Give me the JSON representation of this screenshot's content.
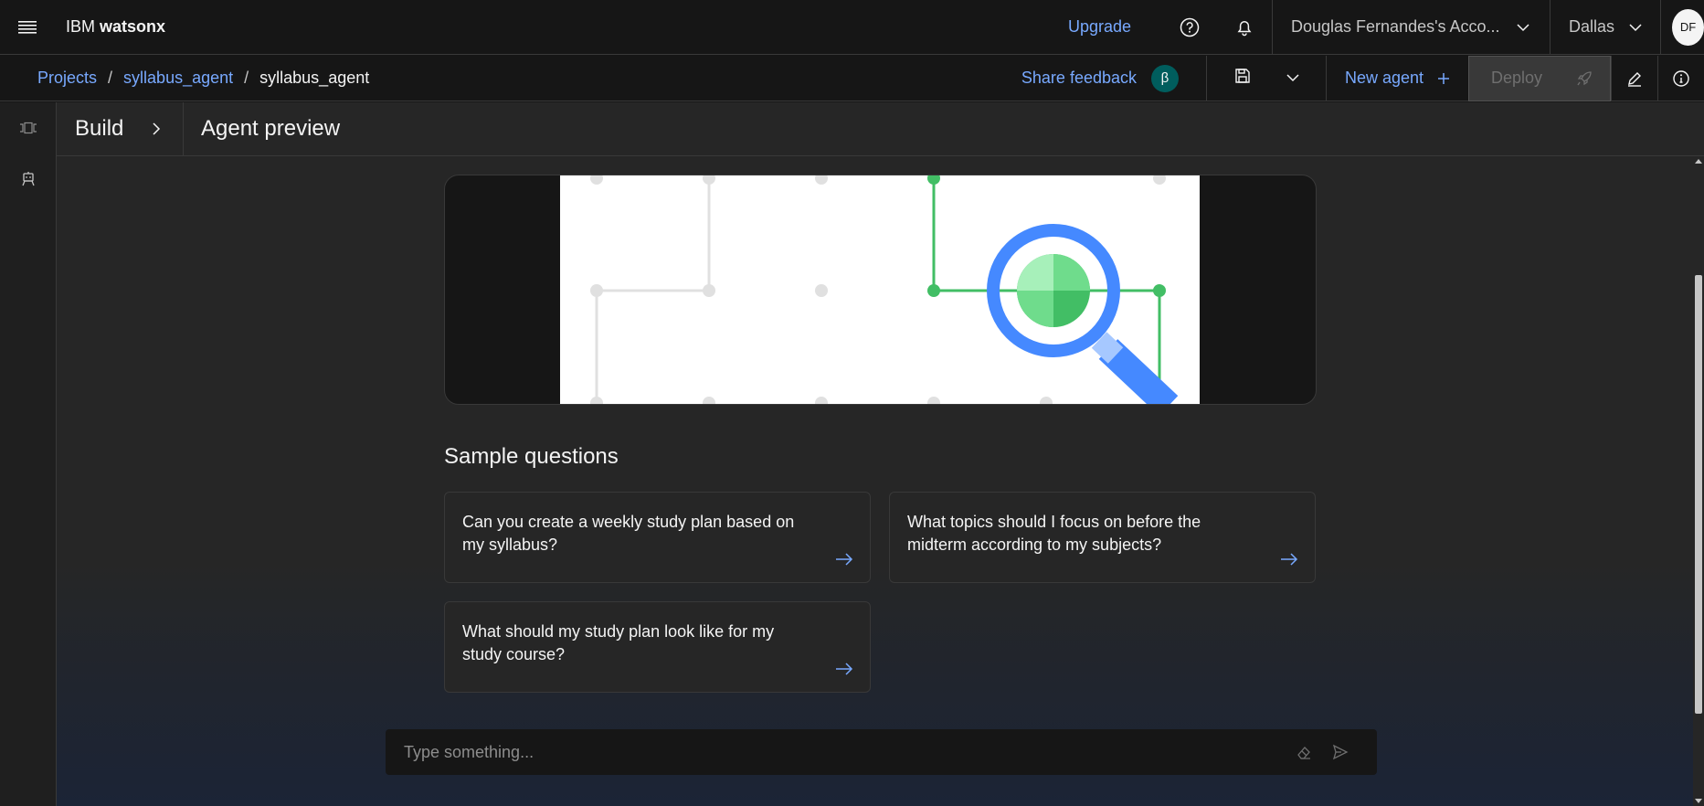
{
  "header": {
    "brand_prefix": "IBM",
    "brand_name": "watsonx",
    "upgrade_label": "Upgrade",
    "account_label": "Douglas Fernandes's Acco...",
    "region_label": "Dallas",
    "avatar_initials": "DF"
  },
  "breadcrumb": {
    "items": [
      "Projects",
      "syllabus_agent"
    ],
    "current": "syllabus_agent",
    "separator": "/"
  },
  "toolbar": {
    "share_feedback_label": "Share feedback",
    "beta_badge": "β",
    "new_agent_label": "New agent",
    "deploy_label": "Deploy"
  },
  "panel": {
    "build_label": "Build",
    "title": "Agent preview"
  },
  "sample_questions": {
    "title": "Sample questions",
    "items": [
      "Can you create a weekly study plan based on my syllabus?",
      "What topics should I focus on before the midterm according to my subjects?",
      "What should my study plan look like for my study course?"
    ]
  },
  "composer": {
    "placeholder": "Type something..."
  },
  "colors": {
    "link": "#78a9ff",
    "accent_green": "#42be65",
    "accent_blue": "#4589ff",
    "beta_bg": "#005d5d"
  }
}
